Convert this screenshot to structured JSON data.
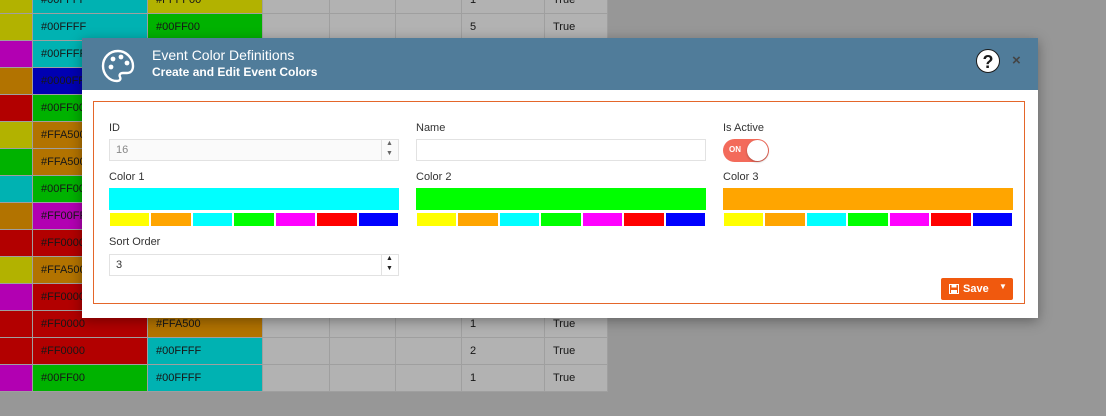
{
  "background_rows": [
    {
      "swatch": "#FFFF00",
      "c1": "#00FFFF",
      "c1bg": "#00FFFF",
      "c2": "#FFFF00",
      "c2bg": "#FFFF00",
      "sort": "1",
      "active": "True"
    },
    {
      "swatch": "#FFFF00",
      "c1": "#00FFFF",
      "c1bg": "#00FFFF",
      "c2": "#00FF00",
      "c2bg": "#00FF00",
      "sort": "5",
      "active": "True"
    },
    {
      "swatch": "#FF00FF",
      "c1": "#00FFFF",
      "c1bg": "#00FFFF",
      "c2": "",
      "c2bg": "#FFFFFF",
      "sort": "",
      "active": ""
    },
    {
      "swatch": "#FFA500",
      "c1": "#0000FF",
      "c1bg": "#0000FF",
      "c2": "",
      "c2bg": "#FFFFFF",
      "sort": "",
      "active": ""
    },
    {
      "swatch": "#FF0000",
      "c1": "#00FF00",
      "c1bg": "#00FF00",
      "c2": "",
      "c2bg": "#FFFFFF",
      "sort": "",
      "active": ""
    },
    {
      "swatch": "#FFFF00",
      "c1": "#FFA500",
      "c1bg": "#FFA500",
      "c2": "",
      "c2bg": "#FFFFFF",
      "sort": "",
      "active": ""
    },
    {
      "swatch": "#00FF00",
      "c1": "#FFA500",
      "c1bg": "#FFA500",
      "c2": "",
      "c2bg": "#FFFFFF",
      "sort": "",
      "active": ""
    },
    {
      "swatch": "#00FFFF",
      "c1": "#00FF00",
      "c1bg": "#00FF00",
      "c2": "",
      "c2bg": "#FFFFFF",
      "sort": "",
      "active": ""
    },
    {
      "swatch": "#FFA500",
      "c1": "#FF00FF",
      "c1bg": "#FF00FF",
      "c2": "",
      "c2bg": "#FFFFFF",
      "sort": "",
      "active": ""
    },
    {
      "swatch": "#FF0000",
      "c1": "#FF0000",
      "c1bg": "#FF0000",
      "c2": "",
      "c2bg": "#FFFFFF",
      "sort": "",
      "active": ""
    },
    {
      "swatch": "#FFFF00",
      "c1": "#FFA500",
      "c1bg": "#FFA500",
      "c2": "",
      "c2bg": "#FFFFFF",
      "sort": "",
      "active": ""
    },
    {
      "swatch": "#FF00FF",
      "c1": "#FF0000",
      "c1bg": "#FF0000",
      "c2": "",
      "c2bg": "#FFFFFF",
      "sort": "",
      "active": ""
    },
    {
      "swatch": "#FF0000",
      "c1": "#FF0000",
      "c1bg": "#FF0000",
      "c2": "#FFA500",
      "c2bg": "#FFA500",
      "sort": "1",
      "active": "True"
    },
    {
      "swatch": "#FF0000",
      "c1": "#FF0000",
      "c1bg": "#FF0000",
      "c2": "#00FFFF",
      "c2bg": "#00FFFF",
      "sort": "2",
      "active": "True"
    },
    {
      "swatch": "#FF00FF",
      "c1": "#00FF00",
      "c1bg": "#00FF00",
      "c2": "#00FFFF",
      "c2bg": "#00FFFF",
      "sort": "1",
      "active": "True"
    }
  ],
  "modal": {
    "title": "Event Color Definitions",
    "subtitle": "Create and Edit Event Colors",
    "header_icon": "palette-icon",
    "help_text": "?",
    "close_text": "×",
    "accent": "#507c9a"
  },
  "form": {
    "id_label": "ID",
    "id_value": "16",
    "name_label": "Name",
    "name_value": "",
    "active_label": "Is Active",
    "active_state": "ON",
    "color1_label": "Color 1",
    "color1_value": "#00FFFF",
    "color2_label": "Color 2",
    "color2_value": "#00FF00",
    "color3_label": "Color 3",
    "color3_value": "#FFA500",
    "sort_label": "Sort Order",
    "sort_value": "3",
    "palette": [
      "#FFFF00",
      "#FFA500",
      "#00FFFF",
      "#00FF00",
      "#FF00FF",
      "#FF0000",
      "#0000FF"
    ],
    "save_label": "Save",
    "save_color": "#f0590e"
  }
}
